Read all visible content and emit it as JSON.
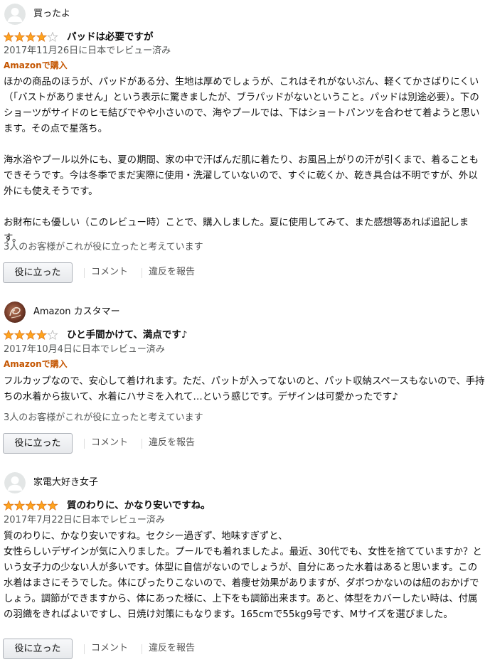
{
  "colors": {
    "star": "#ffa41c",
    "verified": "#c45500",
    "muted": "#565959",
    "button_border": "#adb1b8"
  },
  "reviews": [
    {
      "reviewer": "買ったよ",
      "avatar_icon": "default-user-avatar-icon",
      "rating": 4,
      "rating_max": 5,
      "title": "パッドは必要ですが",
      "date": "2017年11月26日に日本でレビュー済み",
      "verified": "Amazonで購入",
      "body": [
        "ほかの商品のほうが、パッドがある分、生地は厚めでしょうが、これはそれがないぶん、軽くてかさばりにくい（「バストがありません」という表示に驚きましたが、ブラパッドがないということ。パッドは別途必要）。下のショーツがサイドのヒモ結びでやや小さいので、海やプールでは、下はショートパンツを合わせて着ようと思います。その点で星落ち。",
        "海水浴やプール以外にも、夏の期間、家の中で汗ばんだ肌に着たり、お風呂上がりの汗が引くまで、着ることもできそうです。今は冬季でまだ実際に使用・洗濯していないので、すぐに乾くか、乾き具合は不明ですが、外以外にも使えそうです。",
        "お財布にも優しい（このレビュー時）ことで、購入しました。夏に使用してみて、また感想等あれば追記します。"
      ],
      "helpful_count": "3人のお客様がこれが役に立ったと考えています",
      "helpful_button": "役に立った",
      "comment_link": "コメント",
      "report_link": "違反を報告"
    },
    {
      "reviewer": "Amazon カスタマー",
      "avatar_icon": "custom-profile-photo-icon",
      "rating": 4,
      "rating_max": 5,
      "title": "ひと手間かけて、満点です♪",
      "date": "2017年10月4日に日本でレビュー済み",
      "verified": "Amazonで購入",
      "body": [
        "フルカップなので、安心して着けれます。ただ、パットが入ってないのと、パット収納スペースもないので、手持ちの水着から抜いて、水着にハサミを入れて…という感じです。デザインは可愛かったです♪"
      ],
      "helpful_count": "3人のお客様がこれが役に立ったと考えています",
      "helpful_button": "役に立った",
      "comment_link": "コメント",
      "report_link": "違反を報告"
    },
    {
      "reviewer": "家電大好き女子",
      "avatar_icon": "default-user-avatar-icon",
      "rating": 5,
      "rating_max": 5,
      "title": "質のわりに、かなり安いですね。",
      "date": "2017年7月22日に日本でレビュー済み",
      "body": [
        "質のわりに、かなり安いですね。セクシー過ぎず、地味すぎずと、\n女性らしいデザインが気に入りました。プールでも着れましたよ。最近、30代でも、女性を捨てていますか？という女子力の少ない人が多いです。体型に自信がないのでしょうが、自分にあった水着はあると思います。この水着はまさにそうでした。体にぴったりこないので、着痩せ効果がありますが、ダボつかないのは紐のおかげでしょう。調節ができますから、体にあった様に、上下をも調節出来ます。あと、体型をカバーしたい時は、付属の羽織をきればよいですし、日焼け対策にもなります。165cmで55kg9号です、Mサイズを選びました。"
      ],
      "helpful_button": "役に立った",
      "comment_link": "コメント",
      "report_link": "違反を報告"
    }
  ]
}
